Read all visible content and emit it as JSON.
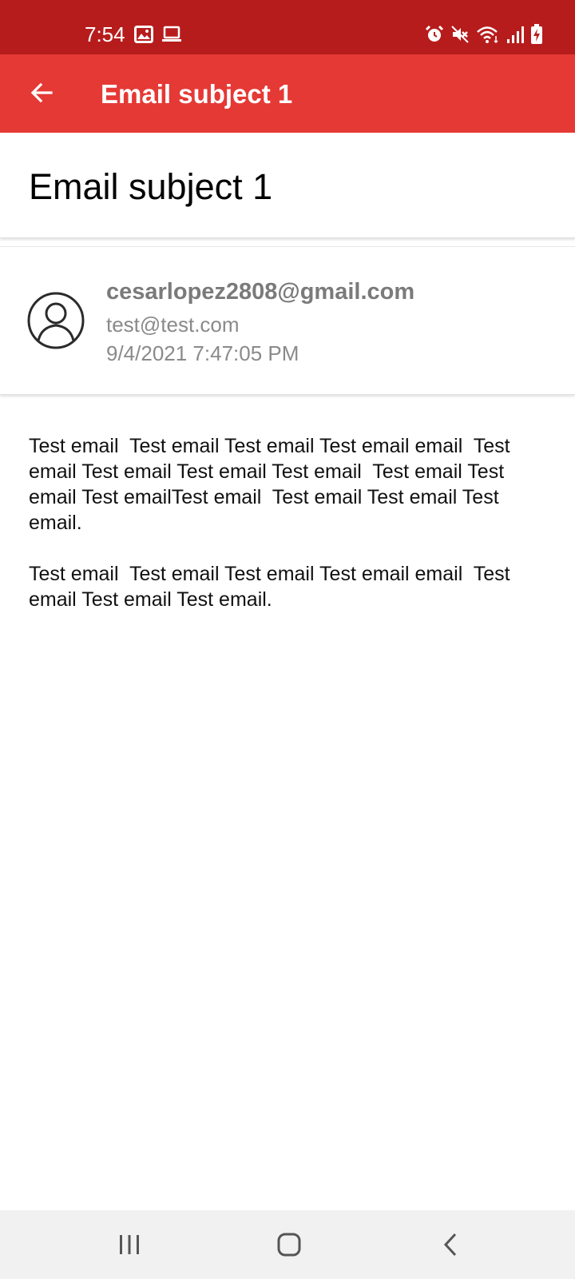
{
  "status_bar": {
    "time": "7:54",
    "icons_left": [
      "image-icon",
      "laptop-icon"
    ],
    "icons_right": [
      "alarm-icon",
      "mute-icon",
      "wifi-icon",
      "signal-icon",
      "battery-charging-icon"
    ],
    "background": "#b71c1c"
  },
  "app_bar": {
    "title": "Email subject 1",
    "background": "#e53935"
  },
  "email": {
    "subject": "Email subject 1",
    "from": "cesarlopez2808@gmail.com",
    "to": "test@test.com",
    "date": "9/4/2021 7:47:05 PM",
    "body_paragraphs": [
      "Test email  Test email Test email Test email email  Test email Test email Test email Test email  Test email Test email Test emailTest email  Test email Test email Test email.",
      "Test email  Test email Test email Test email email  Test email Test email Test email."
    ]
  },
  "nav_bar": {
    "buttons": [
      "recent-apps-icon",
      "home-icon",
      "back-icon"
    ]
  }
}
